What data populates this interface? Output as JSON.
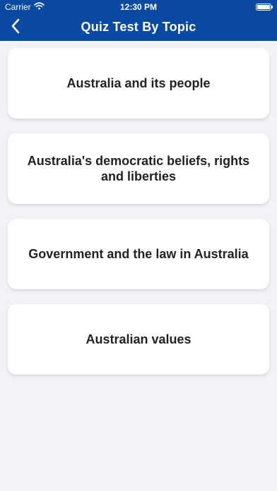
{
  "status_bar": {
    "carrier": "Carrier",
    "time": "12:30 PM"
  },
  "header": {
    "title": "Quiz Test By Topic",
    "back_icon": "chevron-left-icon"
  },
  "colors": {
    "header_background": "#0b4aa2",
    "page_background": "#f2f2f7",
    "card_background": "#ffffff"
  },
  "topics": [
    {
      "label": "Australia and its people"
    },
    {
      "label": "Australia's democratic beliefs, rights and liberties"
    },
    {
      "label": "Government and the law in Australia"
    },
    {
      "label": "Australian values"
    }
  ]
}
